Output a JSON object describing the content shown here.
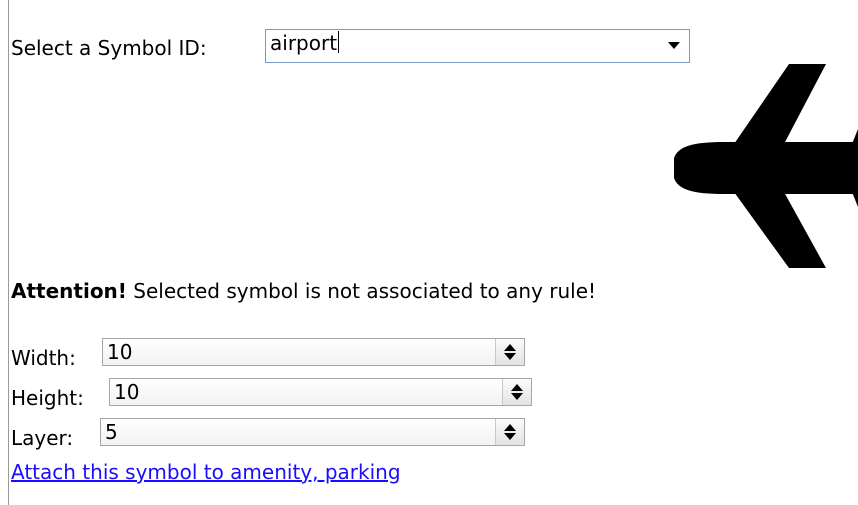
{
  "symbol_select": {
    "label": "Select a Symbol ID:",
    "value": "airport"
  },
  "preview": {
    "icon": "airplane-icon"
  },
  "attention": {
    "bold": "Attention!",
    "message": " Selected symbol is not associated to any rule!"
  },
  "fields": {
    "width": {
      "label": "Width:",
      "value": "10"
    },
    "height": {
      "label": "Height:",
      "value": "10"
    },
    "layer": {
      "label": "Layer:",
      "value": "5"
    }
  },
  "attach_link": "Attach this symbol to amenity, parking"
}
